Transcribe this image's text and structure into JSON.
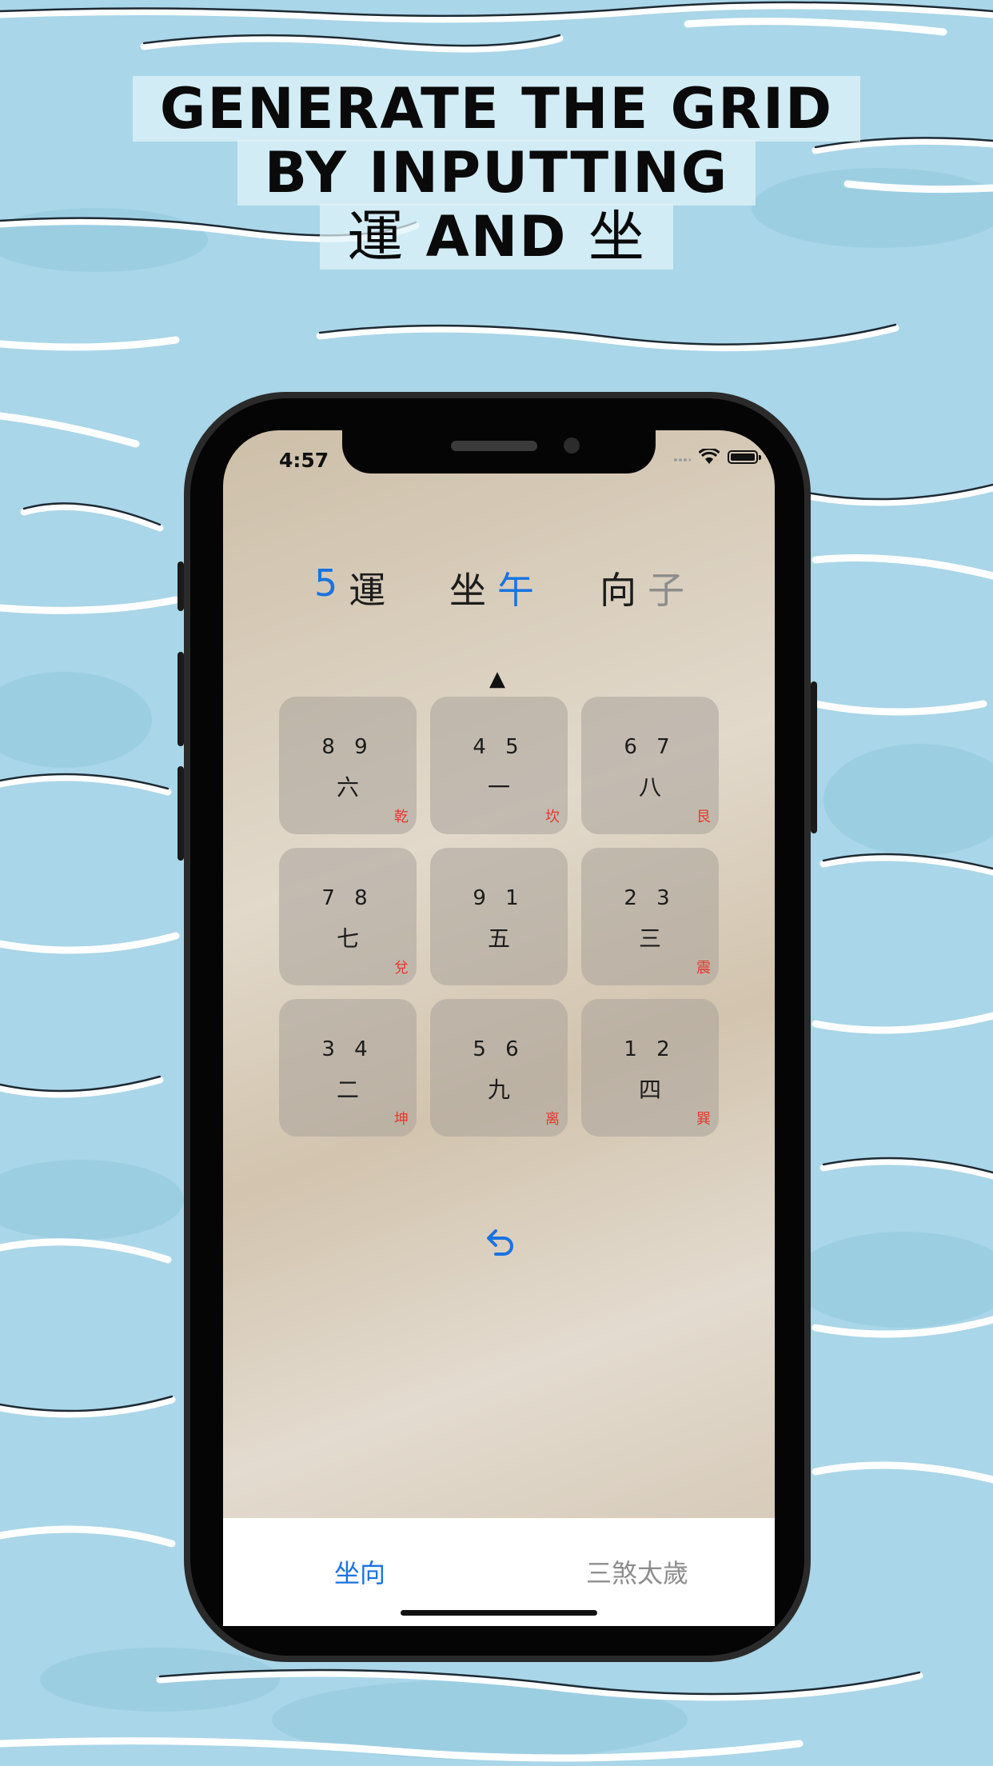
{
  "headline": {
    "line1": "GENERATE THE GRID",
    "line2": "BY INPUTTING",
    "line3_left": "運",
    "line3_mid": "AND",
    "line3_right": "坐"
  },
  "status_bar": {
    "time": "4:57"
  },
  "selectors": {
    "period_number": "5",
    "period_label": "運",
    "sit_label": "坐",
    "sit_value": "午",
    "face_label": "向",
    "face_value": "子"
  },
  "pointer": "▲",
  "grid": [
    {
      "stars": "8 9",
      "base": "六",
      "gua": "乾"
    },
    {
      "stars": "4 5",
      "base": "一",
      "gua": "坎"
    },
    {
      "stars": "6 7",
      "base": "八",
      "gua": "艮"
    },
    {
      "stars": "7 8",
      "base": "七",
      "gua": "兌"
    },
    {
      "stars": "9 1",
      "base": "五",
      "gua": ""
    },
    {
      "stars": "2 3",
      "base": "三",
      "gua": "震"
    },
    {
      "stars": "3 4",
      "base": "二",
      "gua": "坤"
    },
    {
      "stars": "5 6",
      "base": "九",
      "gua": "离"
    },
    {
      "stars": "1 2",
      "base": "四",
      "gua": "巽"
    }
  ],
  "tabs": {
    "tab1": "坐向",
    "tab2": "三煞太歲"
  },
  "colors": {
    "accent": "#1a73e0",
    "gua_red": "#e23a2f",
    "background": "#a9d6e8"
  },
  "icons": {
    "undo": "undo-arrow-icon",
    "wifi": "wifi-icon",
    "battery": "battery-icon",
    "signal": "signal-icon"
  }
}
